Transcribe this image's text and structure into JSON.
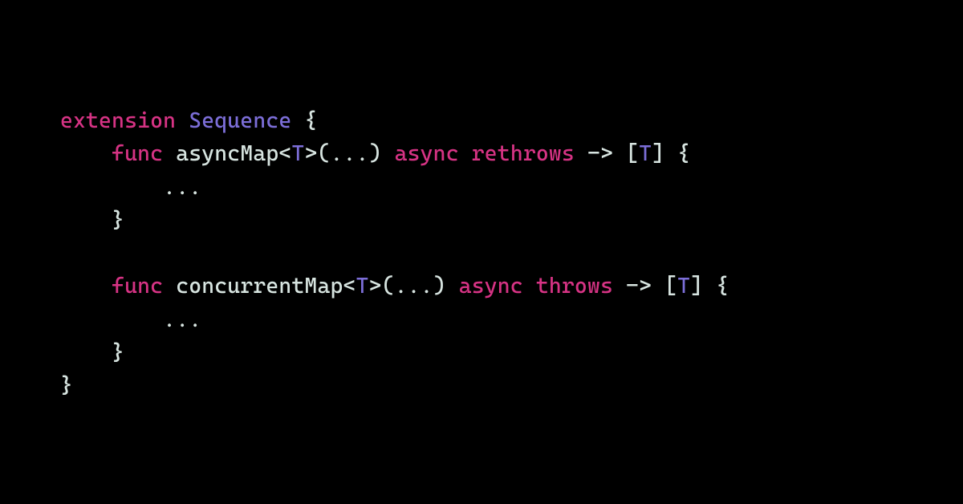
{
  "colors": {
    "background": "#000000",
    "keyword": "#d63384",
    "type": "#7c6ed8",
    "default": "#d7e4e0"
  },
  "code": {
    "line1": {
      "kw_extension": "extension",
      "sp1": " ",
      "type_sequence": "Sequence",
      "sp2": " ",
      "brace_open": "{"
    },
    "line2": {
      "indent": "    ",
      "kw_func": "func",
      "sp1": " ",
      "name": "asyncMap",
      "lt": "<",
      "generic": "T",
      "gt": ">",
      "params": "(...)",
      "sp2": " ",
      "kw_async": "async",
      "sp3": " ",
      "kw_rethrows": "rethrows",
      "sp4": " ",
      "arrow": "->",
      "sp5": " ",
      "lbracket": "[",
      "ret_type": "T",
      "rbracket": "]",
      "sp6": " ",
      "brace_open": "{"
    },
    "line3": {
      "indent": "        ",
      "body": "..."
    },
    "line4": {
      "indent": "    ",
      "brace_close": "}"
    },
    "line5_blank": "",
    "line6": {
      "indent": "    ",
      "kw_func": "func",
      "sp1": " ",
      "name": "concurrentMap",
      "lt": "<",
      "generic": "T",
      "gt": ">",
      "params": "(...)",
      "sp2": " ",
      "kw_async": "async",
      "sp3": " ",
      "kw_throws": "throws",
      "sp4": " ",
      "arrow": "->",
      "sp5": " ",
      "lbracket": "[",
      "ret_type": "T",
      "rbracket": "]",
      "sp6": " ",
      "brace_open": "{"
    },
    "line7": {
      "indent": "        ",
      "body": "..."
    },
    "line8": {
      "indent": "    ",
      "brace_close": "}"
    },
    "line9": {
      "brace_close": "}"
    }
  }
}
